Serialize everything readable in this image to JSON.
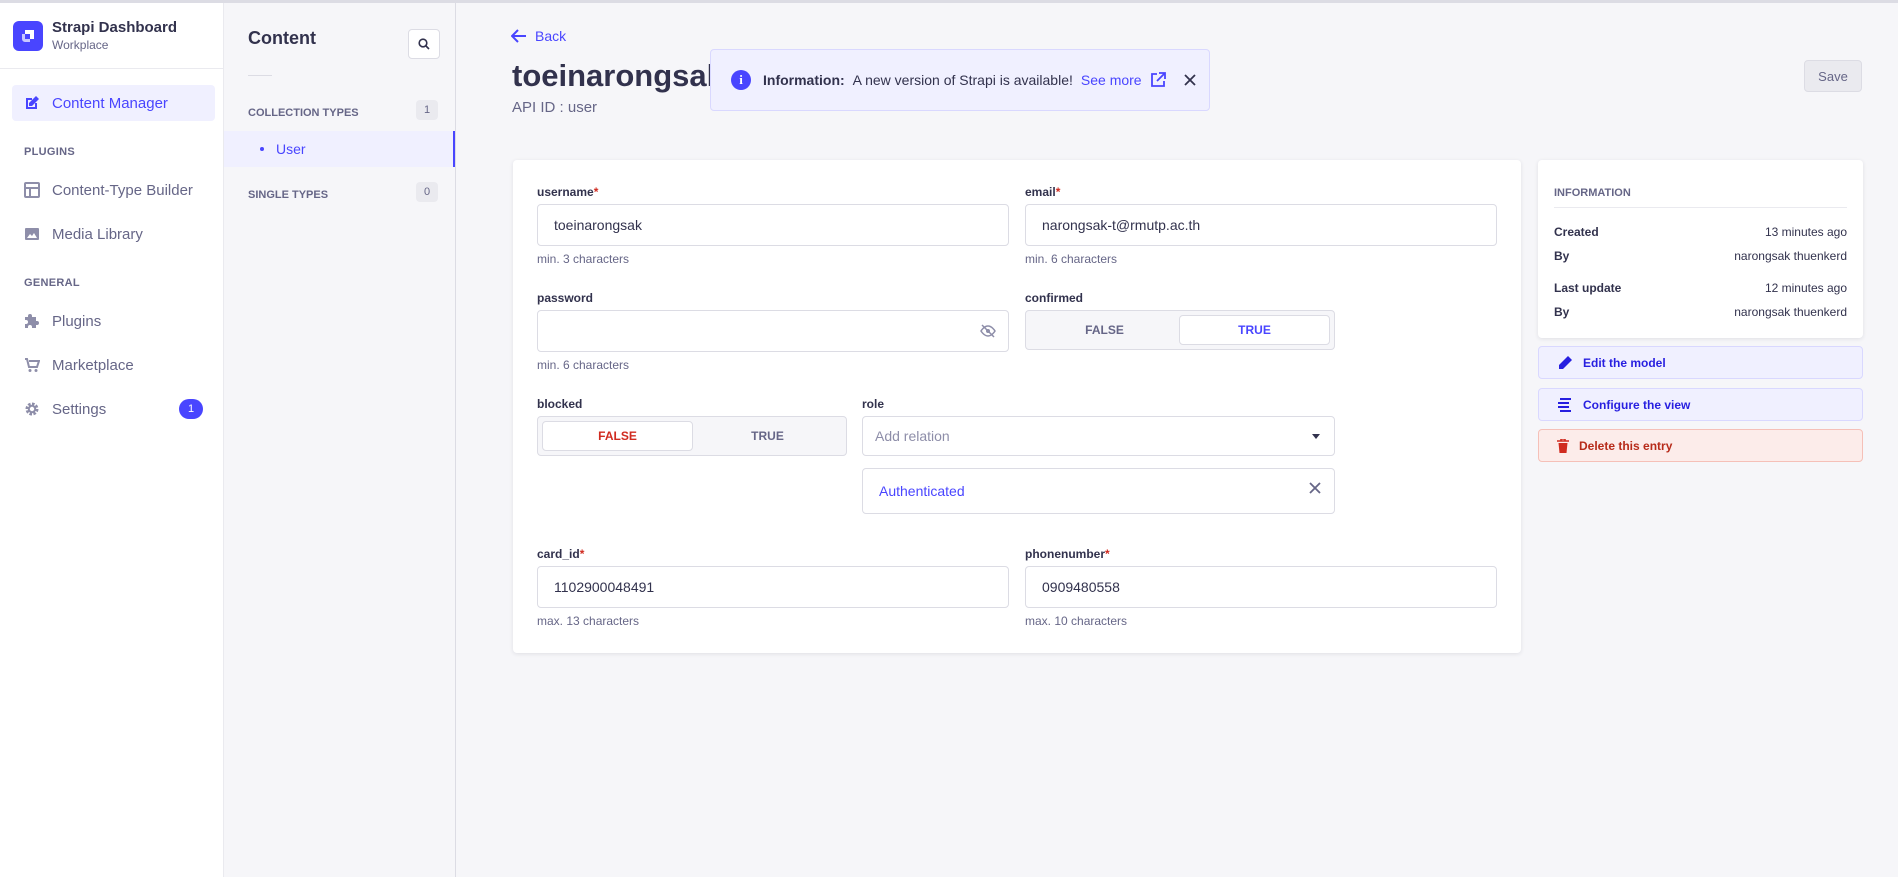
{
  "brand": {
    "title": "Strapi Dashboard",
    "subtitle": "Workplace"
  },
  "mainnav": {
    "content_manager": "Content Manager",
    "plugins_section": "PLUGINS",
    "content_type_builder": "Content-Type Builder",
    "media_library": "Media Library",
    "general_section": "GENERAL",
    "plugins": "Plugins",
    "marketplace": "Marketplace",
    "settings": "Settings",
    "settings_badge": "1"
  },
  "subnav": {
    "title": "Content",
    "collection_types": "COLLECTION TYPES",
    "collection_count": "1",
    "user_item": "User",
    "single_types": "SINGLE TYPES",
    "single_count": "0"
  },
  "header": {
    "back": "Back",
    "title": "toeinarongsak",
    "api_id": "API ID : user",
    "save": "Save"
  },
  "notification": {
    "title": "Information:",
    "message": "A new version of Strapi is available!",
    "link": "See more"
  },
  "form": {
    "username": {
      "label": "username",
      "value": "toeinarongsak",
      "hint": "min. 3 characters"
    },
    "email": {
      "label": "email",
      "value": "narongsak-t@rmutp.ac.th",
      "hint": "min. 6 characters"
    },
    "password": {
      "label": "password",
      "value": "",
      "hint": "min. 6 characters"
    },
    "confirmed": {
      "label": "confirmed",
      "false": "FALSE",
      "true": "TRUE",
      "value": true
    },
    "blocked": {
      "label": "blocked",
      "false": "FALSE",
      "true": "TRUE",
      "value": false
    },
    "role": {
      "label": "role",
      "placeholder": "Add relation",
      "selected": "Authenticated"
    },
    "card_id": {
      "label": "card_id",
      "value": "1102900048491",
      "hint": "max. 13 characters"
    },
    "phonenumber": {
      "label": "phonenumber",
      "value": "0909480558",
      "hint": "max. 10 characters"
    },
    "required_mark": "*"
  },
  "information": {
    "heading": "INFORMATION",
    "created_label": "Created",
    "created_value": "13 minutes ago",
    "by_label": "By",
    "created_by": "narongsak thuenkerd",
    "updated_label": "Last update",
    "updated_value": "12 minutes ago",
    "updated_by": "narongsak thuenkerd"
  },
  "actions": {
    "edit_model": "Edit the model",
    "configure_view": "Configure the view",
    "delete_entry": "Delete this entry"
  },
  "colors": {
    "primary": "#4945ff",
    "danger": "#d02b20",
    "background": "#f6f6f9"
  }
}
